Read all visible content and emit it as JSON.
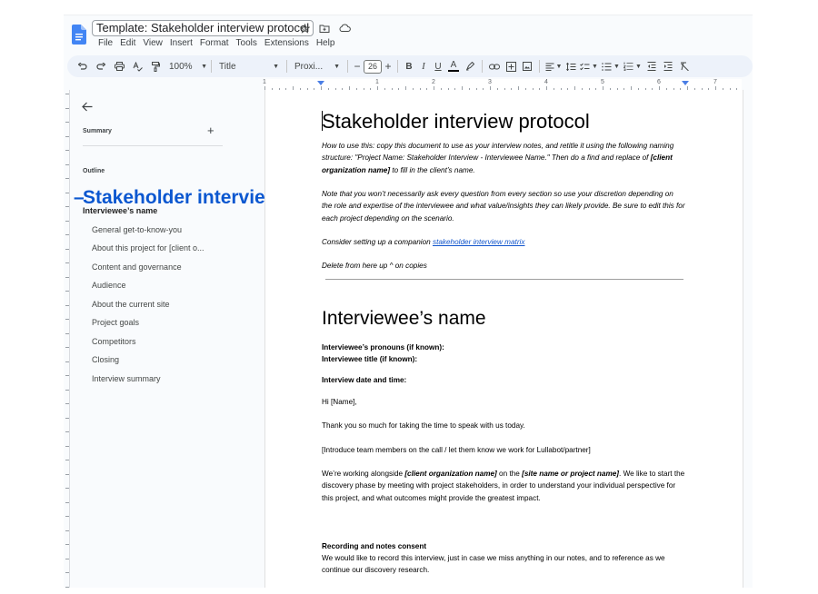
{
  "app": {
    "doc_title": "Template: Stakeholder interview protocol",
    "title_icons": [
      "star-icon",
      "move-to-folder-icon",
      "cloud-status-icon"
    ],
    "menu": [
      "File",
      "Edit",
      "View",
      "Insert",
      "Format",
      "Tools",
      "Extensions",
      "Help"
    ]
  },
  "toolbar": {
    "zoom": "100%",
    "style": "Title",
    "font": "Proxi...",
    "font_size": "26",
    "minus": "−",
    "plus": "+",
    "bold": "B",
    "italic": "I",
    "underline": "U",
    "text_color": "A",
    "text_color_value": "#000000"
  },
  "ruler": {
    "labels": [
      "1",
      "1",
      "2",
      "3",
      "4",
      "5",
      "6",
      "7"
    ]
  },
  "sidebar": {
    "summary_label": "Summary",
    "add_label": "+",
    "outline_label": "Outline",
    "outline": [
      {
        "level": 1,
        "label": "Stakeholder interview protocol",
        "active": true
      },
      {
        "level": 2,
        "label": "Interviewee’s name"
      },
      {
        "level": 3,
        "label": "General get-to-know-you"
      },
      {
        "level": 3,
        "label": "About this project for [client o..."
      },
      {
        "level": 3,
        "label": "Content and governance"
      },
      {
        "level": 3,
        "label": "Audience"
      },
      {
        "level": 3,
        "label": "About the current site"
      },
      {
        "level": 3,
        "label": "Project goals"
      },
      {
        "level": 3,
        "label": "Competitors"
      },
      {
        "level": 3,
        "label": "Closing"
      },
      {
        "level": 3,
        "label": "Interview summary"
      }
    ],
    "active_color": "#0b57d0"
  },
  "document": {
    "title": "Stakeholder interview protocol",
    "intro1_a": "How to use this: copy this document to use as your interview notes, and retitle it using the following naming structure: \"Project Name: Stakeholder Interview - Interviewee Name.\" Then do a find and replace of ",
    "intro1_b": "[client organization name]",
    "intro1_c": " to fill in the client’s name.",
    "intro2": "Note that you won’t necessarily ask every question from every section so use your discretion depending on the role and expertise of the interviewee and what value/insights they can likely provide. Be sure to edit this for each project depending on the scenario.",
    "intro3_a": "Consider setting up a companion ",
    "intro3_link": "stakeholder interview matrix",
    "intro4": "Delete from here up ^ on copies",
    "heading": "Interviewee’s name",
    "pronouns": "Interviewee’s pronouns (if known):",
    "ititle": "Interviewee title (if known):",
    "date": "Interview date and time:",
    "greeting": "Hi [Name],",
    "thanks": "Thank you so much for taking the time to speak with us today.",
    "introduce": "[Introduce team members on the call / let them know we work for Lullabot/partner]",
    "working_a": "We’re working alongside ",
    "working_b": "[client organization name]",
    "working_c": " on the ",
    "working_d": "[site name or project name]",
    "working_e": ".  We like to start the discovery phase by meeting with project stakeholders, in order to understand your individual perspective for this project, and what outcomes might provide the greatest impact.",
    "consent_heading": "Recording and notes consent",
    "consent_text": "We would like to record this interview, just in case we miss anything in our notes, and to reference as we continue our discovery research."
  }
}
